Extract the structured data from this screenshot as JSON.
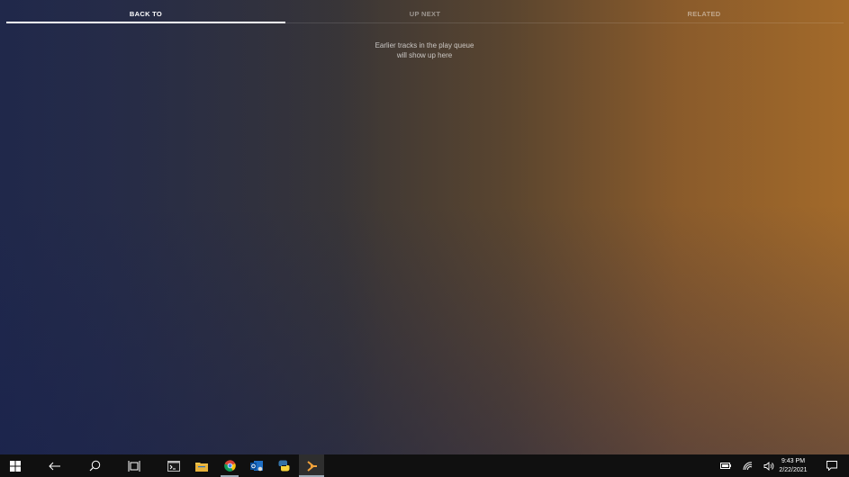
{
  "tabs": [
    {
      "label": "BACK TO",
      "active": true
    },
    {
      "label": "UP NEXT",
      "active": false
    },
    {
      "label": "RELATED",
      "active": false
    }
  ],
  "empty_state": {
    "line1": "Earlier tracks in the play queue",
    "line2": "will show up here"
  },
  "taskbar": {
    "icons": [
      "windows-start-icon",
      "back-arrow-icon",
      "search-icon",
      "task-view-icon",
      "terminal-icon",
      "file-explorer-icon",
      "chrome-icon",
      "outlook-icon",
      "python-icon",
      "music-app-icon"
    ],
    "tray_icons": [
      "battery-icon",
      "wifi-icon",
      "volume-icon",
      "action-center-icon"
    ],
    "time": "9:43 PM",
    "date": "2/22/2021"
  },
  "colors": {
    "accent": "#ffffff",
    "taskbar": "#101010",
    "gradient_left": "#1f2b55",
    "gradient_right": "#a36a2a"
  }
}
